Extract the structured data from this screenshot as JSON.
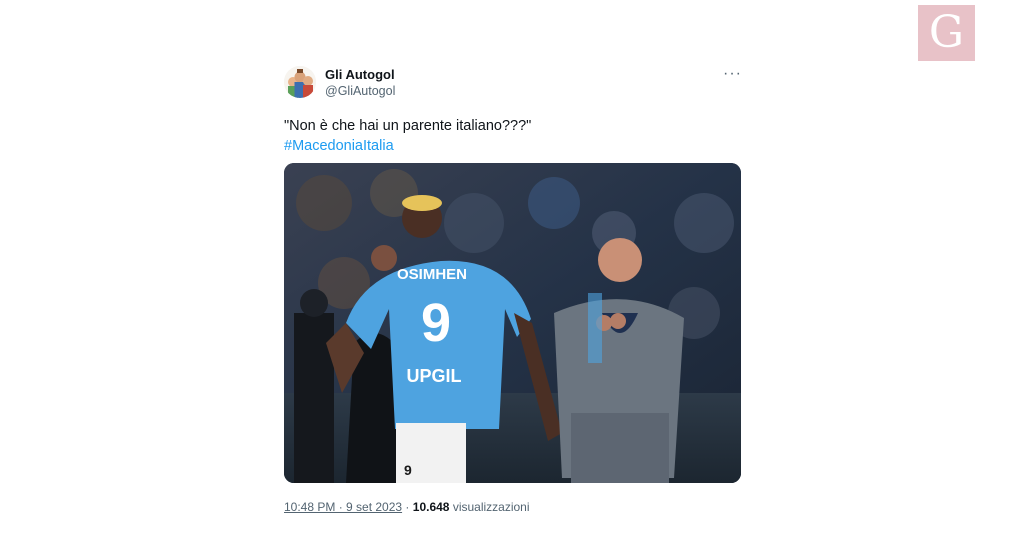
{
  "tweet": {
    "display_name": "Gli Autogol",
    "handle": "@GliAutogol",
    "more_label": "···",
    "text": "\"Non è che hai un parente italiano???\"",
    "hashtag": "#MacedoniaItalia",
    "photo": {
      "jersey_name": "OSIMHEN",
      "jersey_number": "9",
      "shorts_number": "9",
      "sponsor": "UPGIL"
    },
    "timestamp": "10:48 PM · 9 set 2023",
    "separator": "·",
    "views_count": "10.648",
    "views_label": "visualizzazioni"
  },
  "logo": {
    "letter": "G"
  },
  "colors": {
    "accent": "#1d9bf0",
    "text_secondary": "#536471",
    "logo_bg": "#e8c2c8",
    "jersey_blue": "#4ea3e0"
  },
  "icons": {
    "more": "more-horizontal-icon",
    "avatar": "avatar-cartoon"
  }
}
